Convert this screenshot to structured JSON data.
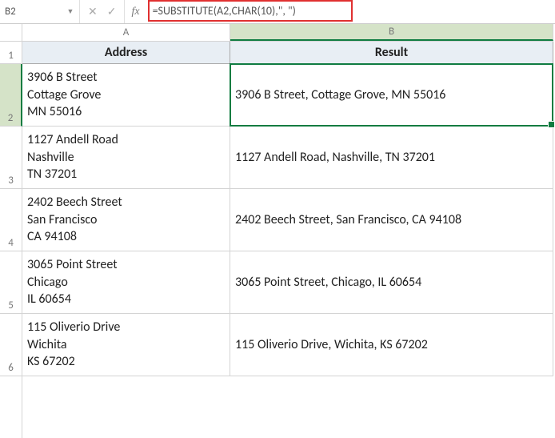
{
  "formula_bar": {
    "cell_ref": "B2",
    "formula": "=SUBSTITUTE(A2,CHAR(10),\", \")"
  },
  "chart_data": {
    "type": "table",
    "columns": [
      "A",
      "B"
    ],
    "headers": {
      "A": "Address",
      "B": "Result"
    },
    "rows": [
      {
        "n": "1",
        "A": "Address",
        "B": "Result"
      },
      {
        "n": "2",
        "A": "3906 B Street\nCottage Grove\nMN 55016",
        "B": "3906 B Street, Cottage Grove, MN 55016"
      },
      {
        "n": "3",
        "A": "1127 Andell Road\nNashville\nTN 37201",
        "B": "1127 Andell Road, Nashville, TN 37201"
      },
      {
        "n": "4",
        "A": "2402 Beech Street\nSan Francisco\nCA 94108",
        "B": "2402 Beech Street, San Francisco, CA 94108"
      },
      {
        "n": "5",
        "A": "3065 Point Street\nChicago\nIL 60654",
        "B": "3065 Point Street, Chicago, IL 60654"
      },
      {
        "n": "6",
        "A": "115 Oliverio Drive\nWichita\nKS 67202",
        "B": "115 Oliverio Drive, Wichita, KS 67202"
      }
    ],
    "selected_cell": "B2"
  }
}
